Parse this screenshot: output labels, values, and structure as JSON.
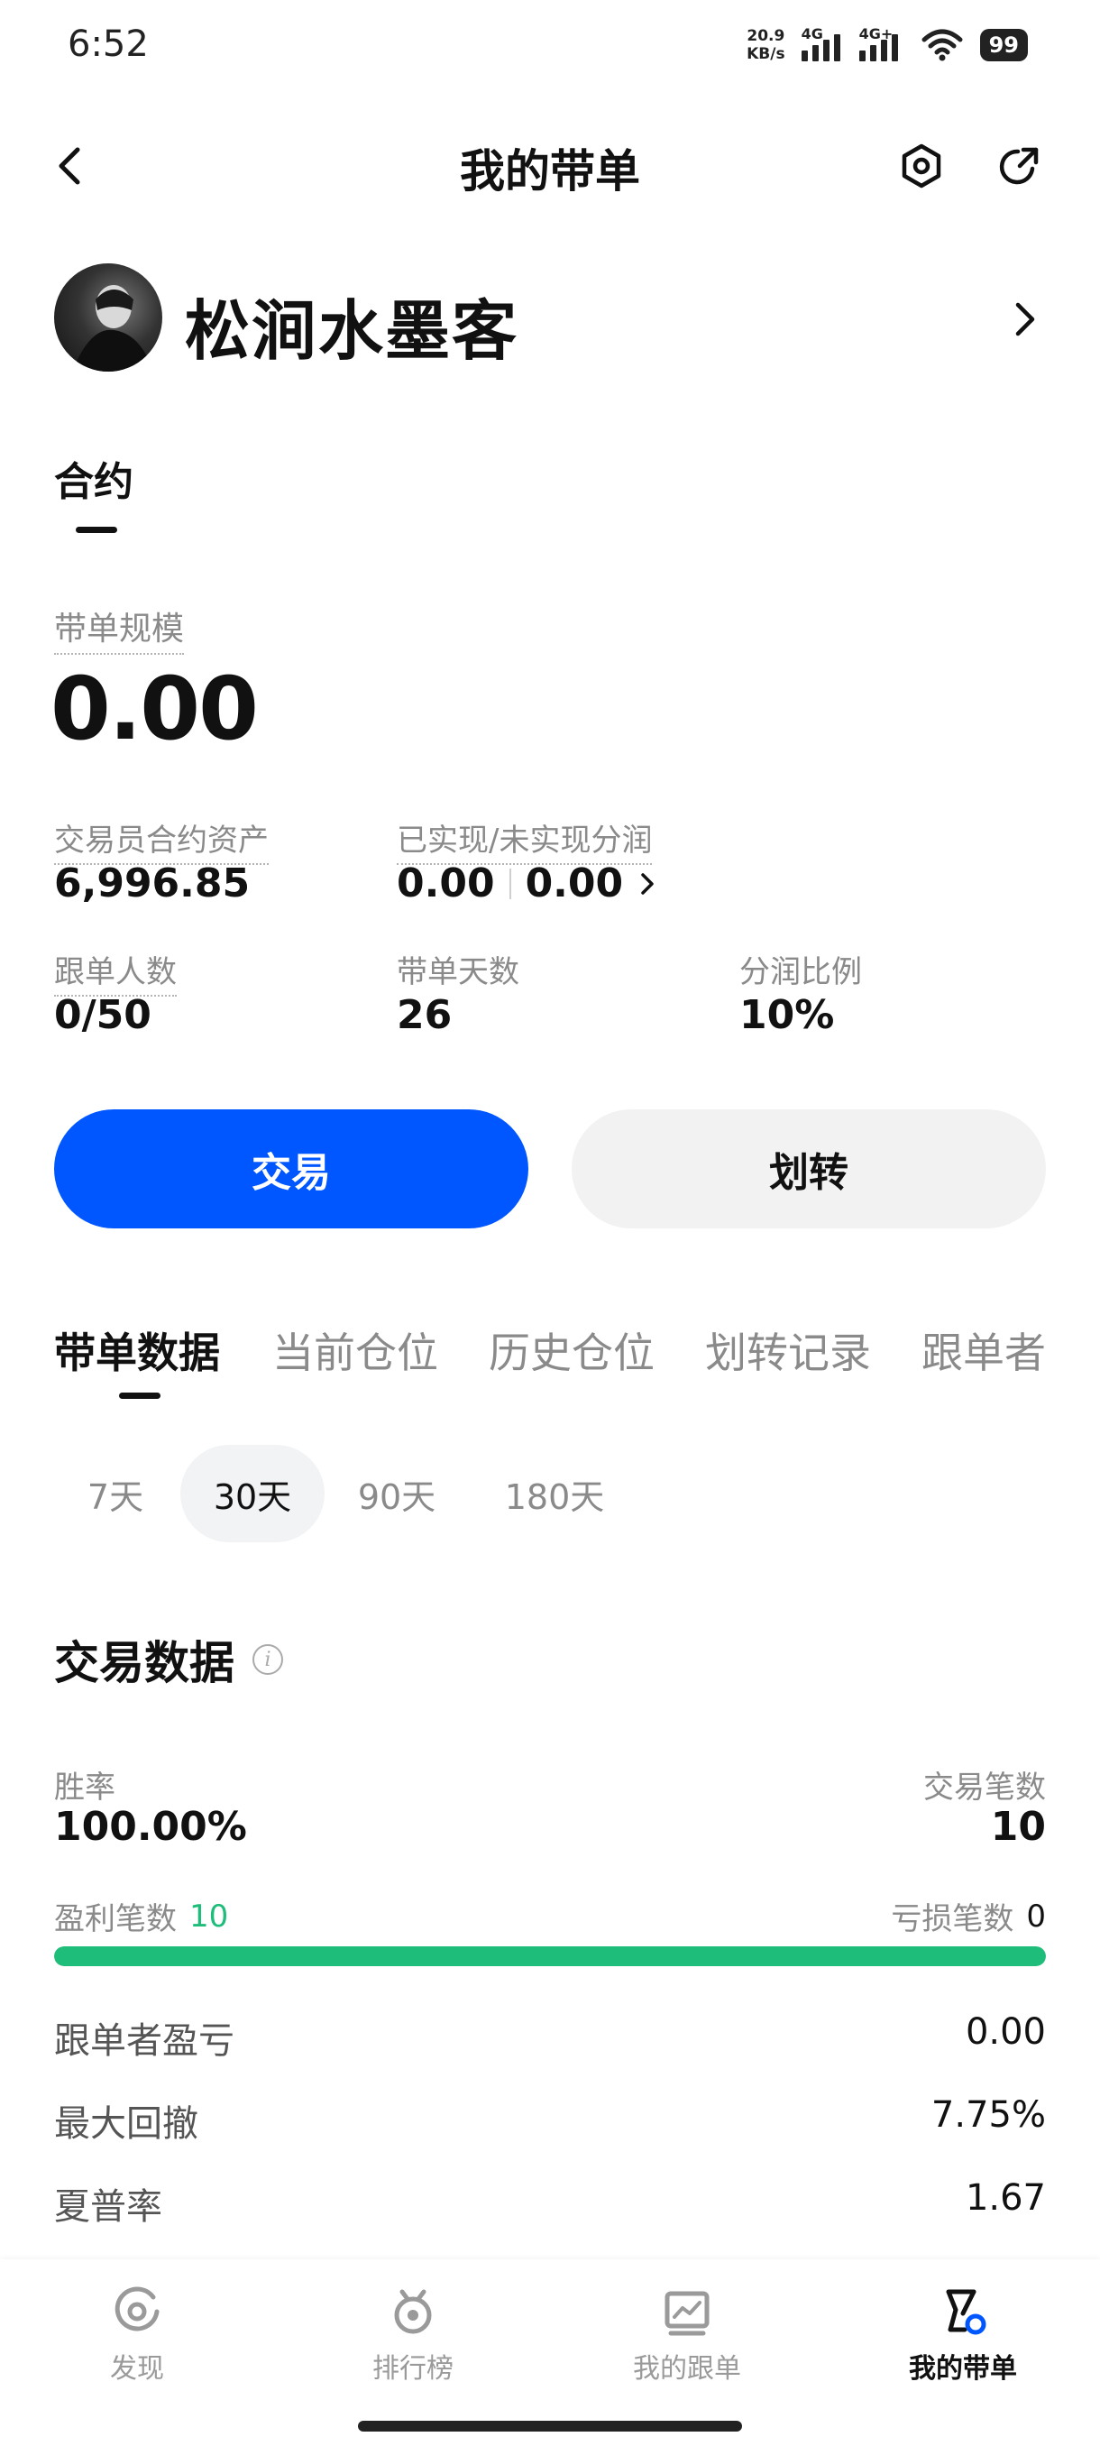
{
  "status_bar": {
    "time": "6:52",
    "net_speed_value": "20.9",
    "net_speed_unit": "KB/s",
    "sim1": "4G",
    "sim2": "4G+",
    "battery": "99"
  },
  "header": {
    "title": "我的带单"
  },
  "profile": {
    "name": "松涧水墨客"
  },
  "contract_tab": "合约",
  "scale": {
    "label": "带单规模",
    "value": "0.00"
  },
  "stats": {
    "trader_assets_label": "交易员合约资产",
    "trader_assets_value": "6,996.85",
    "pnl_label": "已实现/未实现分润",
    "realized": "0.00",
    "unrealized": "0.00",
    "followers_label": "跟单人数",
    "followers_value": "0/50",
    "days_label": "带单天数",
    "days_value": "26",
    "share_label": "分润比例",
    "share_value": "10%"
  },
  "actions": {
    "trade": "交易",
    "transfer": "划转"
  },
  "tabs": [
    {
      "label": "带单数据",
      "active": true
    },
    {
      "label": "当前仓位",
      "active": false
    },
    {
      "label": "历史仓位",
      "active": false
    },
    {
      "label": "划转记录",
      "active": false
    },
    {
      "label": "跟单者",
      "active": false
    }
  ],
  "periods": [
    {
      "label": "7天",
      "active": false
    },
    {
      "label": "30天",
      "active": true
    },
    {
      "label": "90天",
      "active": false
    },
    {
      "label": "180天",
      "active": false
    }
  ],
  "trade_data": {
    "title": "交易数据",
    "win_rate_label": "胜率",
    "win_rate_value": "100.00%",
    "trades_label": "交易笔数",
    "trades_value": "10",
    "profit_trades_label": "盈利笔数",
    "profit_trades_value": "10",
    "loss_trades_label": "亏损笔数",
    "loss_trades_value": "0",
    "win_fraction": 1.0,
    "metrics": [
      {
        "label": "跟单者盈亏",
        "value": "0.00"
      },
      {
        "label": "最大回撤",
        "value": "7.75%"
      },
      {
        "label": "夏普率",
        "value": "1.67"
      }
    ]
  },
  "colors": {
    "primary": "#0057ff",
    "profit_green": "#1ebd7a",
    "loss": "#111111"
  },
  "bottom_nav": [
    {
      "label": "发现",
      "icon": "discover-icon",
      "active": false
    },
    {
      "label": "排行榜",
      "icon": "leaderboard-icon",
      "active": false
    },
    {
      "label": "我的跟单",
      "icon": "my-follow-icon",
      "active": false
    },
    {
      "label": "我的带单",
      "icon": "my-lead-icon",
      "active": true
    }
  ]
}
